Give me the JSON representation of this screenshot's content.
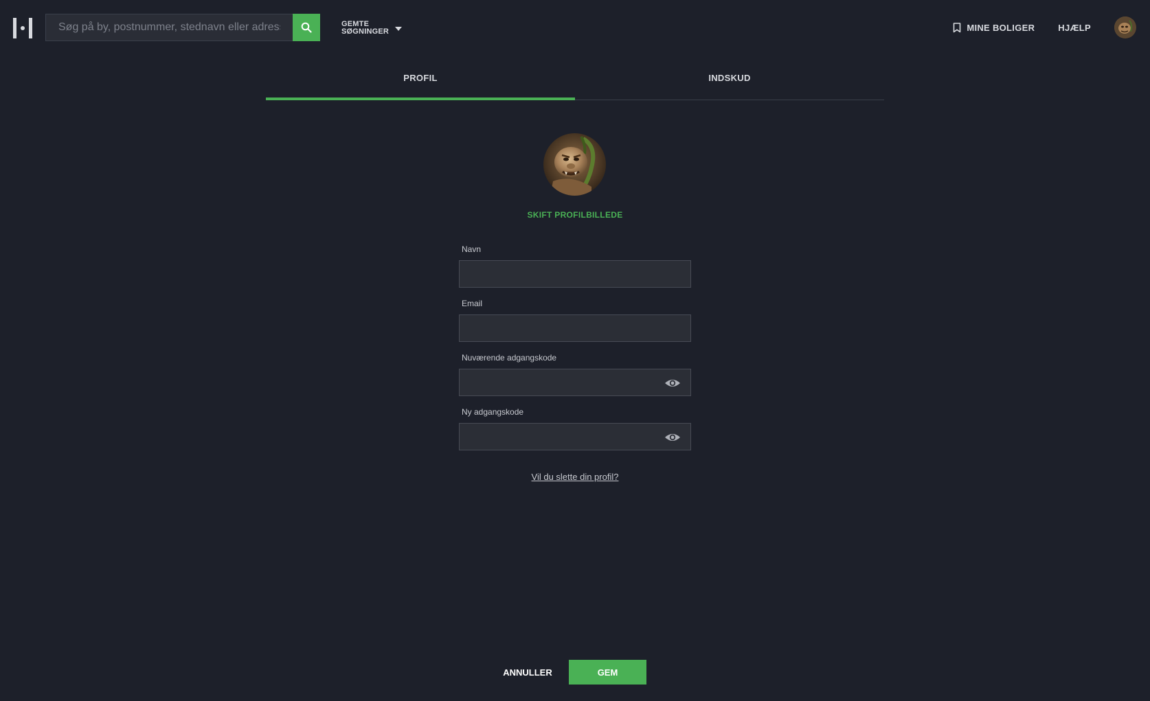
{
  "header": {
    "logo_icon": "brand-logo-icon",
    "search": {
      "placeholder": "Søg på by, postnummer, stednavn eller adresse",
      "value": "",
      "button_icon": "search-icon"
    },
    "saved_searches": {
      "label_line1": "GEMTE",
      "label_line2": "SØGNINGER",
      "icon": "chevron-down-icon"
    },
    "nav": {
      "my_homes": "MINE BOLIGER",
      "my_homes_icon": "bookmark-icon",
      "help": "HJÆLP"
    },
    "user_avatar_icon": "user-avatar"
  },
  "tabs": [
    {
      "label": "PROFIL",
      "active": true
    },
    {
      "label": "INDSKUD",
      "active": false
    }
  ],
  "profile": {
    "change_photo_label": "SKIFT PROFILBILLEDE"
  },
  "form": {
    "name": {
      "label": "Navn",
      "value": ""
    },
    "email": {
      "label": "Email",
      "value": ""
    },
    "current_password": {
      "label": "Nuværende adgangskode",
      "value": "",
      "icon": "eye-icon"
    },
    "new_password": {
      "label": "Ny adgangskode",
      "value": "",
      "icon": "eye-icon"
    }
  },
  "delete_profile_link": "Vil du slette din profil?",
  "actions": {
    "cancel_label": "ANNULLER",
    "save_label": "GEM"
  },
  "colors": {
    "background": "#1d202a",
    "accent": "#4ab155",
    "input_bg": "#2b2e36",
    "text": "#d8dadf"
  }
}
